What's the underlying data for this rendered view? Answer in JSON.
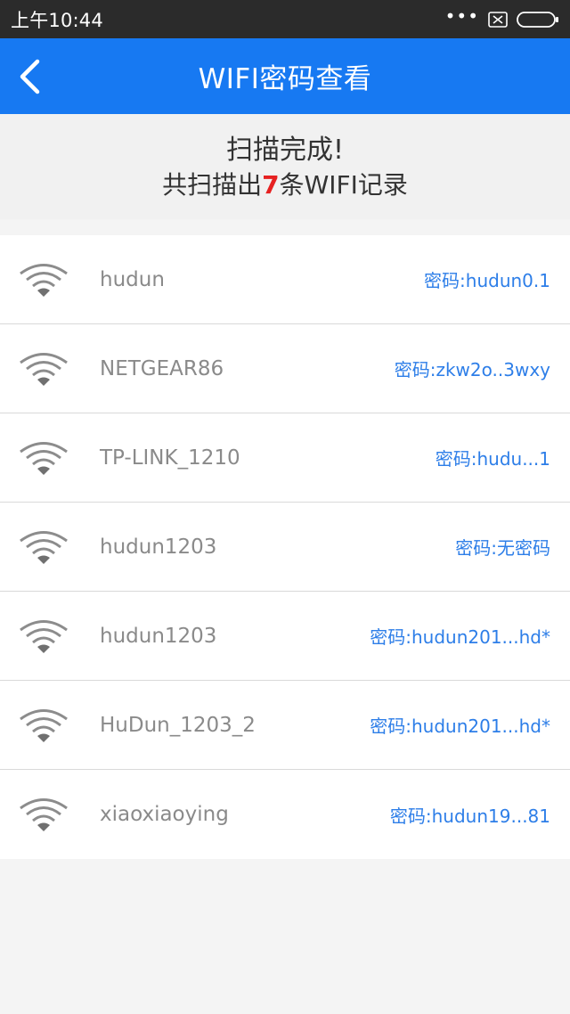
{
  "status_bar": {
    "time": "上午10:44",
    "more": "•••"
  },
  "header": {
    "title": "WIFI密码查看"
  },
  "summary": {
    "title": "扫描完成!",
    "prefix": "共扫描出",
    "count": "7",
    "suffix": "条WIFI记录"
  },
  "wifi_list": [
    {
      "ssid": "hudun",
      "password": "密码:hudun0.1"
    },
    {
      "ssid": "NETGEAR86",
      "password": "密码:zkw2o..3wxy"
    },
    {
      "ssid": "TP-LINK_1210",
      "password": "密码:hudu...1"
    },
    {
      "ssid": "hudun1203",
      "password": "密码:无密码"
    },
    {
      "ssid": "hudun1203",
      "password": "密码:hudun201...hd*"
    },
    {
      "ssid": "HuDun_1203_2",
      "password": "密码:hudun201...hd*"
    },
    {
      "ssid": "xiaoxiaoying",
      "password": "密码:hudun19...81"
    }
  ],
  "colors": {
    "app_bar": "#1779f2",
    "status_bar": "#2b2b2b",
    "count_highlight": "#e62121",
    "password_text": "#2d7ee8"
  }
}
